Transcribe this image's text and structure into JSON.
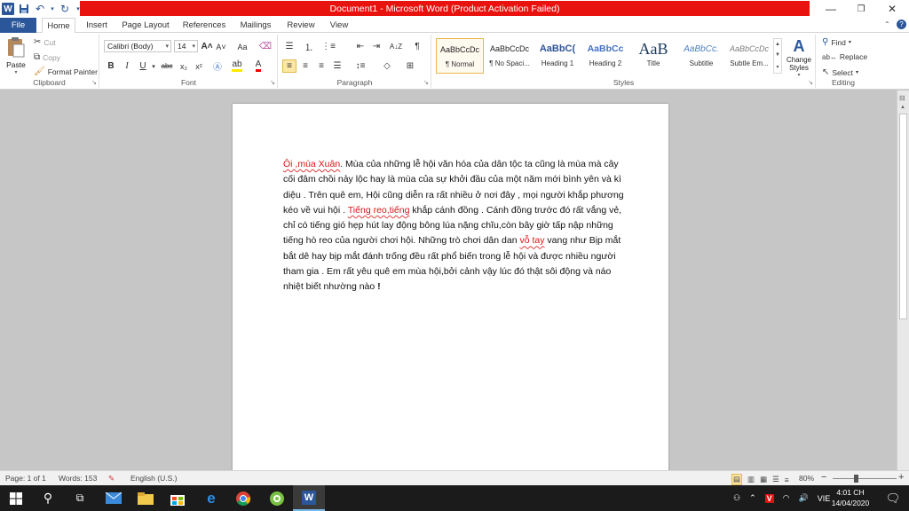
{
  "window": {
    "title": "Document1 - Microsoft Word (Product Activation Failed)",
    "controls": {
      "minimize": "—",
      "restore": "❐",
      "close": "✕"
    }
  },
  "quick_access": {
    "word_logo": "W",
    "save": "💾",
    "undo": "↶",
    "redo": "↻"
  },
  "tabs": [
    "File",
    "Home",
    "Insert",
    "Page Layout",
    "References",
    "Mailings",
    "Review",
    "View"
  ],
  "active_tab": "Home",
  "ribbon": {
    "clipboard": {
      "label": "Clipboard",
      "paste": "Paste",
      "cut": "Cut",
      "copy": "Copy",
      "format_painter": "Format Painter"
    },
    "font": {
      "label": "Font",
      "font_name": "Calibri (Body)",
      "font_size": "14",
      "bold": "B",
      "italic": "I",
      "underline": "U",
      "strike": "abc",
      "subscript": "x₂",
      "superscript": "x²",
      "grow": "A˄",
      "shrink": "A˅",
      "case": "Aa",
      "clear": "A"
    },
    "paragraph": {
      "label": "Paragraph",
      "pilcrow": "¶",
      "sort": "A↓Z"
    },
    "styles": {
      "label": "Styles",
      "items": [
        {
          "preview": "AaBbCcDc",
          "name": "¶ Normal"
        },
        {
          "preview": "AaBbCcDc",
          "name": "¶ No Spaci..."
        },
        {
          "preview": "AaBbC(",
          "name": "Heading 1"
        },
        {
          "preview": "AaBbCc",
          "name": "Heading 2"
        },
        {
          "preview": "AaB",
          "name": "Title"
        },
        {
          "preview": "AaBbCc.",
          "name": "Subtitle"
        },
        {
          "preview": "AaBbCcDc",
          "name": "Subtle Em..."
        }
      ],
      "change_styles": "Change Styles"
    },
    "editing": {
      "label": "Editing",
      "find": "Find",
      "replace": "Replace",
      "select": "Select"
    }
  },
  "document": {
    "seg1": "Ôi ,mùa Xuân",
    "seg2": ". Mùa của những lễ hội văn hóa của dân tộc ta cũng là mùa mà cây cối đâm chồi nảy lộc hay là mùa của sự khởi đầu của một năm mới bình yên và kì diệu . Trên quê em, Hội cũng diễn ra rất nhiều ở nơi đây , mọi người khắp phương kéo về vui hội . ",
    "seg3": "Tiếng reo,tiếng",
    "seg4": " khắp cánh đồng . Cánh đồng trước đó rất vắng vẻ, chỉ có tiếng gió hẹp hút lay động bông lúa nặng chĩu,còn bây giờ tấp nập những tiếng hò reo của người chơi hội. Những trò chơi dân dan ",
    "seg5": "vỗ tay",
    "seg6": " vang như Bịp mắt bắt dê hay bịp mắt đánh trống đều rất phổ biến trong lễ hội và được nhiều người tham gia . Em rất yêu quê em mùa hội,bởi cảnh vậy lúc đó thật sôi động và náo nhiệt biết nhường nào ",
    "seg7": "!"
  },
  "status": {
    "page": "Page: 1 of 1",
    "words": "Words: 153",
    "language": "English (U.S.)",
    "zoom": "80%",
    "zoom_minus": "−",
    "zoom_plus": "+"
  },
  "taskbar": {
    "tray_lang": "VIE",
    "time": "4:01 CH",
    "date": "14/04/2020"
  },
  "colors": {
    "accent": "#2b579a",
    "title_bar": "#e8120f",
    "doc_red": "#d81414"
  }
}
